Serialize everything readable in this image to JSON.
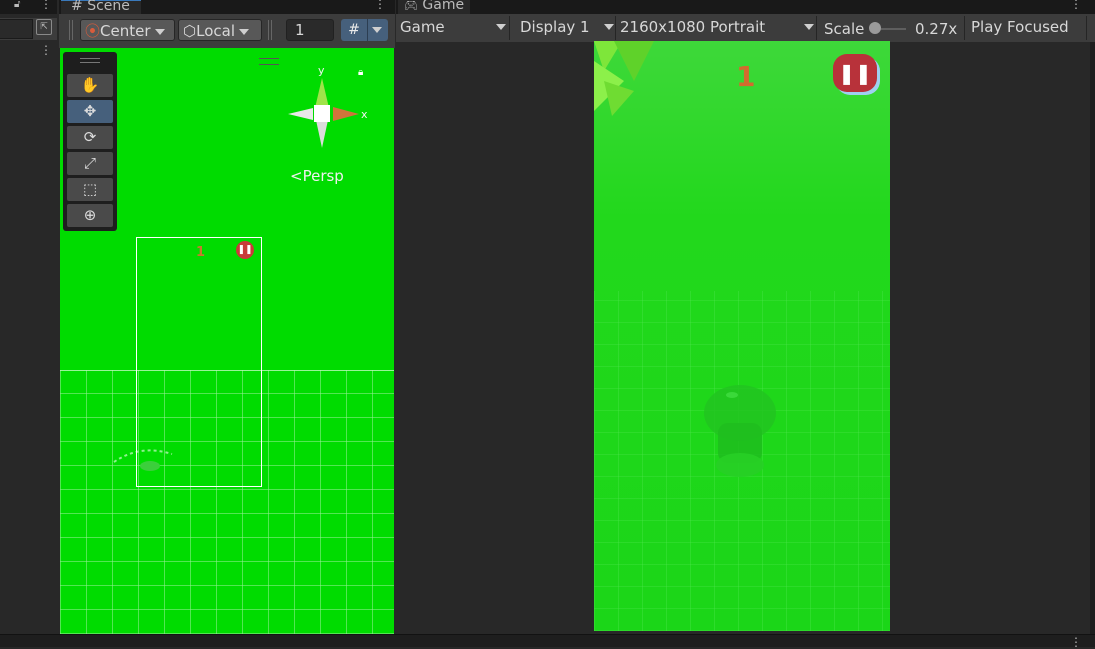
{
  "scene": {
    "tab_label": "Scene",
    "pivot_mode": "Center",
    "pivot_rotation": "Local",
    "grid_snap_value": "1",
    "persp_label": "Persp",
    "gizmo_axis_y": "y",
    "gizmo_axis_x": "x",
    "frame_score": "1",
    "tools": [
      {
        "name": "hand-tool",
        "icon": "✋"
      },
      {
        "name": "move-tool",
        "icon": "✥"
      },
      {
        "name": "rotate-tool",
        "icon": "⟳"
      },
      {
        "name": "scale-tool",
        "icon": "⤢"
      },
      {
        "name": "rect-tool",
        "icon": "⬚"
      },
      {
        "name": "transform-tool",
        "icon": "⊕"
      }
    ],
    "background_color": "#00dc00"
  },
  "game": {
    "tab_label": "Game",
    "view_mode": "Game",
    "display": "Display 1",
    "resolution": "2160x1080 Portrait",
    "scale_label": "Scale",
    "scale_value": "0.27x",
    "play_mode": "Play Focused",
    "score": "1",
    "pause_icon": "pause-icon",
    "accent_color": "#b8323a"
  }
}
